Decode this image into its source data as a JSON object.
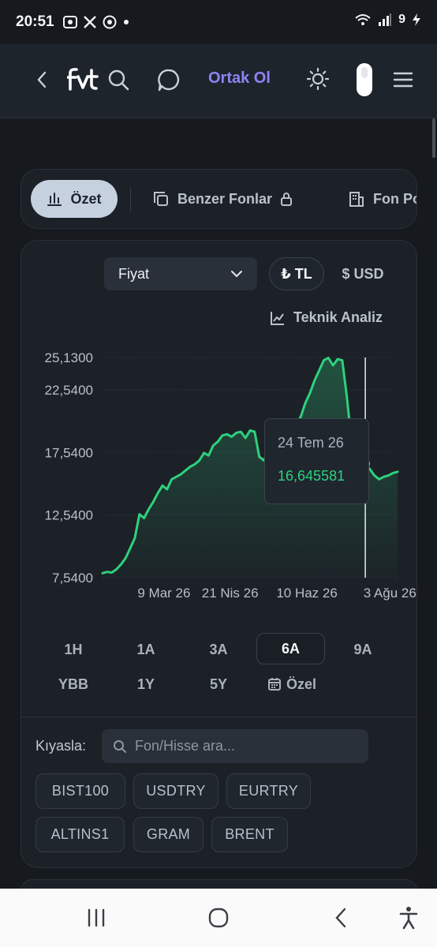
{
  "status": {
    "time": "20:51",
    "battery": "9"
  },
  "nav": {
    "title": "Ortak Ol"
  },
  "tabs": [
    {
      "label": "Özet",
      "icon": "bar-chart-icon"
    },
    {
      "label": "Benzer Fonlar",
      "icon": "copy-icon"
    },
    {
      "label": "Fon Po",
      "icon": "building-icon"
    }
  ],
  "controls": {
    "select_value": "Fiyat",
    "currency_tl": "₺ TL",
    "currency_usd": "$ USD",
    "teknik_label": "Teknik Analiz"
  },
  "chart_data": {
    "type": "area",
    "y_ticks": [
      "25,1300",
      "22,5400",
      "17,5400",
      "12,5400",
      "7,5400"
    ],
    "x_ticks": [
      "9 Mar 26",
      "21 Nis 26",
      "10 Haz 26",
      "3 Ağu 26"
    ],
    "ylim": [
      7.54,
      25.13
    ],
    "line_color": "#2fd07e",
    "series": [
      {
        "x": [
          "2026-01-28",
          "2026-01-31",
          "2026-02-03",
          "2026-02-06",
          "2026-02-09",
          "2026-02-12",
          "2026-02-15",
          "2026-02-18",
          "2026-02-21",
          "2026-02-24",
          "2026-02-27",
          "2026-03-02",
          "2026-03-05",
          "2026-03-08",
          "2026-03-11",
          "2026-03-14",
          "2026-03-17",
          "2026-03-20",
          "2026-03-23",
          "2026-03-26",
          "2026-03-29",
          "2026-04-01",
          "2026-04-04",
          "2026-04-07",
          "2026-04-10",
          "2026-04-13",
          "2026-04-16",
          "2026-04-19",
          "2026-04-22",
          "2026-04-25",
          "2026-04-28",
          "2026-05-01",
          "2026-05-04",
          "2026-05-07",
          "2026-05-10",
          "2026-05-13",
          "2026-05-16",
          "2026-05-19",
          "2026-05-22",
          "2026-05-25",
          "2026-05-28",
          "2026-05-31",
          "2026-06-03",
          "2026-06-06",
          "2026-06-09",
          "2026-06-12",
          "2026-06-15",
          "2026-06-18",
          "2026-06-21",
          "2026-06-24",
          "2026-06-27",
          "2026-06-30",
          "2026-07-03",
          "2026-07-06",
          "2026-07-09",
          "2026-07-12",
          "2026-07-15",
          "2026-07-18",
          "2026-07-21",
          "2026-07-24",
          "2026-07-27",
          "2026-07-30",
          "2026-08-02",
          "2026-08-05",
          "2026-08-08"
        ],
        "y": [
          7.9,
          8.0,
          7.95,
          8.2,
          8.6,
          9.1,
          9.9,
          10.7,
          12.6,
          12.3,
          13.0,
          13.6,
          14.3,
          14.9,
          14.6,
          15.4,
          15.6,
          15.8,
          16.1,
          16.4,
          16.6,
          16.9,
          17.5,
          17.3,
          18.1,
          18.4,
          18.9,
          19.0,
          18.8,
          19.1,
          19.2,
          18.7,
          19.3,
          19.2,
          17.2,
          16.9,
          17.7,
          18.3,
          18.6,
          18.9,
          19.1,
          19.4,
          19.8,
          20.4,
          21.5,
          22.3,
          23.3,
          24.1,
          24.9,
          25.1,
          24.5,
          25.0,
          24.9,
          22.0,
          18.4,
          17.1,
          16.9,
          16.645581,
          16.2,
          15.7,
          15.4,
          15.6,
          15.7,
          15.9,
          16.0
        ]
      }
    ],
    "tooltip": {
      "date": "24 Tem 26",
      "value": "16,645581"
    }
  },
  "ranges": [
    "1H",
    "1A",
    "3A",
    "6A",
    "9A",
    "YBB",
    "1Y",
    "5Y",
    "Özel"
  ],
  "active_range": "6A",
  "compare": {
    "label": "Kıyasla:",
    "placeholder": "Fon/Hisse ara...",
    "chips": [
      "BIST100",
      "USDTRY",
      "EURTRY",
      "ALTINS1",
      "GRAM",
      "BRENT"
    ]
  }
}
